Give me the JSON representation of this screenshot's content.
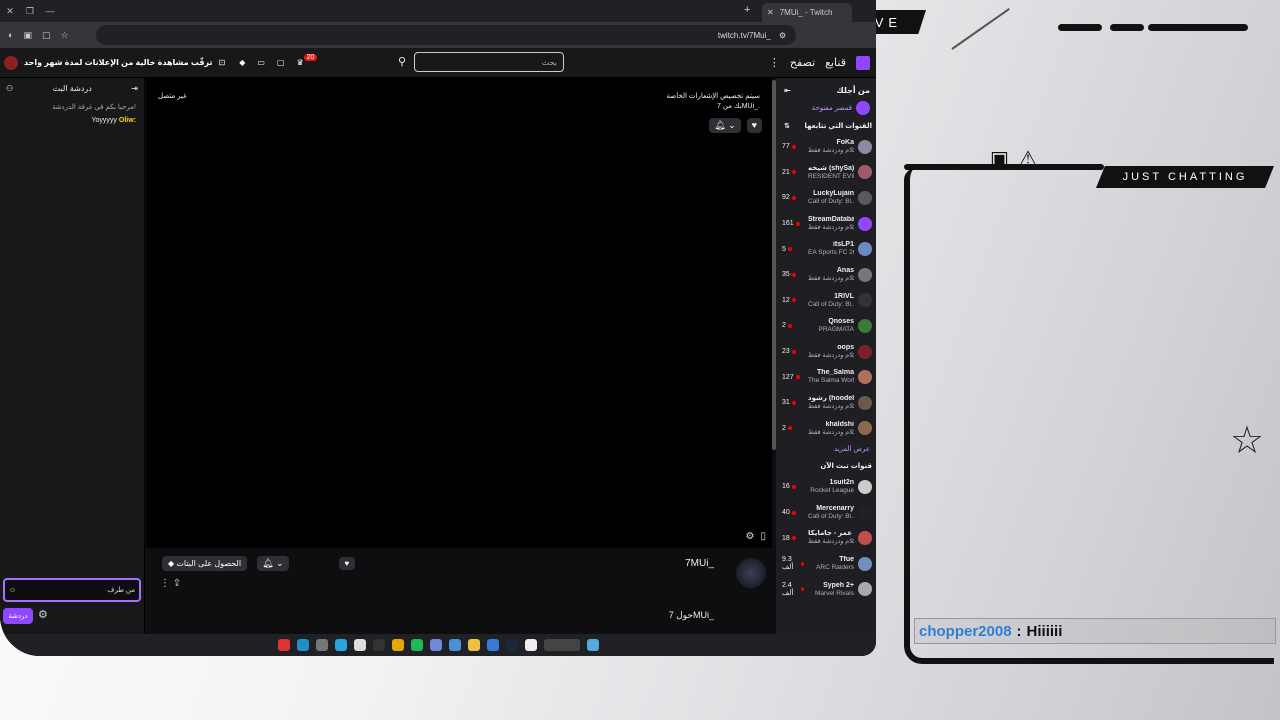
{
  "overlay": {
    "live_label": "LIVE",
    "category_label": "JUST CHATTING",
    "chat_message": {
      "user": "chopper2008",
      "separator": ":",
      "text": "Hiiiiii"
    },
    "accent_user_color": "#2e7ed6"
  },
  "browser": {
    "tab_title": "7MUi_ - Twitch",
    "url": "twitch.tv/7Mui_"
  },
  "twitch": {
    "nav_following": "قنابع",
    "nav_browse": "تصفح",
    "search_placeholder": "بحث",
    "promo_text": "بلا إعلانات لمدة شهر واحد",
    "promo_text_full": "ترقّب مشاهدة خالية من الإعلانات لمدة شهر واحد",
    "notif_count": "20",
    "chat": {
      "title": "دردشة البث",
      "welcome": "مرحبا بكم في غرفة الدردشة!",
      "messages": [
        {
          "user": "Oliw:",
          "text": "Yoyyyyy"
        }
      ],
      "input_placeholder": "من طرف",
      "send_label": "دردشة"
    },
    "player": {
      "offline_label": "غير متصل",
      "notice_line1": "سيتم تخصيص الإشعارات الخاصة",
      "notice_line2": "بك من 7MUi_."
    },
    "channel_info": {
      "name": "7MUi_",
      "subscribe_label": "الحصول على البتات",
      "about_label": "حول 7MUi_"
    },
    "sidebar": {
      "for_you": "من أجلك",
      "open_shop": "قمصر مفتوحة",
      "followed_title": "القنوات التي تتابعها",
      "show_more": "عرض المزيد",
      "live_now_title": "قنوات تبث الآن",
      "followed": [
        {
          "name": "FoKa",
          "game": "كلام ودردشة فقط",
          "viewers": "77",
          "color": "#8a8aa0"
        },
        {
          "name": "شيخه (shySa)",
          "game": "RESIDENT EVIL...",
          "viewers": "21",
          "color": "#a05a6a"
        },
        {
          "name": "LuckyLujain",
          "game": "Call of Duty: Bl...",
          "viewers": "92",
          "color": "#5a5a5a"
        },
        {
          "name": "StreamDatabase",
          "game": "كلام ودردشة فقط",
          "viewers": "161",
          "color": "#9147ff"
        },
        {
          "name": "itsLP1",
          "game": "EA Sports FC 26",
          "viewers": "5",
          "color": "#6a8ac0"
        },
        {
          "name": "Anas",
          "game": "كلام ودردشة فقط",
          "viewers": "35",
          "color": "#777777"
        },
        {
          "name": "1RIVL",
          "game": "Call of Duty: Bl...",
          "viewers": "12",
          "color": "#333333"
        },
        {
          "name": "Qnoses",
          "game": "PRAGMATA",
          "viewers": "2",
          "color": "#3a7a3a"
        },
        {
          "name": "oops",
          "game": "كلام ودردشة فقط",
          "viewers": "23",
          "color": "#7a2030"
        },
        {
          "name": "The_Salma",
          "game": "The Salma World",
          "viewers": "127",
          "color": "#b07060"
        },
        {
          "name": "رشود (hoode88)...",
          "game": "كلام ودردشة فقط",
          "viewers": "31",
          "color": "#6a5a4a"
        },
        {
          "name": "khaldshi",
          "game": "كلام ودردشة فقط",
          "viewers": "2",
          "color": "#8a6a4a"
        }
      ],
      "live_now": [
        {
          "name": "1suit2n",
          "game": "Rocket League",
          "viewers": "16",
          "color": "#cccccc"
        },
        {
          "name": "Mercenarry",
          "game": "Call of Duty: Bl...",
          "viewers": "40",
          "color": "#222222"
        },
        {
          "name": "عمر - جامايكا (jamaica...",
          "game": "كلام ودردشة فقط",
          "viewers": "18",
          "color": "#c05050"
        },
        {
          "name": "Tfue",
          "game": "ARC Raiders",
          "viewers": "9.3 ألف",
          "color": "#7090c0"
        },
        {
          "name": "Sypeh 2+",
          "game": "Marvel Rivals",
          "viewers": "2.4 ألف",
          "color": "#aaaaaa"
        }
      ]
    }
  }
}
